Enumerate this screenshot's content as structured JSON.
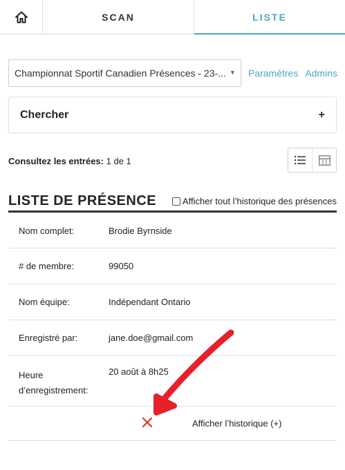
{
  "nav": {
    "home_icon": "home-icon",
    "tabs": [
      {
        "label": "SCAN"
      },
      {
        "label": "LISTE"
      }
    ]
  },
  "event_selector": {
    "selected": "Championnat Sportif Canadien Présences - 23-...",
    "caret": "▼"
  },
  "links": {
    "settings": "Paramètres",
    "admins": "Admins"
  },
  "search": {
    "title": "Chercher",
    "toggle": "+"
  },
  "entries": {
    "label": "Consultez les entrées:",
    "value": "1 de 1"
  },
  "list": {
    "title": "LISTE DE PRÉSENCE",
    "history_checkbox_label": "Afficher tout l’historique des présences"
  },
  "record": {
    "rows": [
      {
        "label": "Nom complet:",
        "value": "Brodie Byrnside"
      },
      {
        "label": "# de membre:",
        "value": "99050"
      },
      {
        "label": "Nom équipe:",
        "value": "Indépendant Ontario"
      },
      {
        "label": "Enregistré par:",
        "value": "jane.doe@gmail.com"
      },
      {
        "label_line1": "Heure",
        "label_line2": "d’enregistrement:",
        "value": "20 août à 8h25"
      }
    ],
    "show_history": "Afficher l’historique (+)"
  },
  "colors": {
    "accent": "#4aa8c4",
    "annotation_red": "#e8202a",
    "delete_red": "#e0302a"
  }
}
